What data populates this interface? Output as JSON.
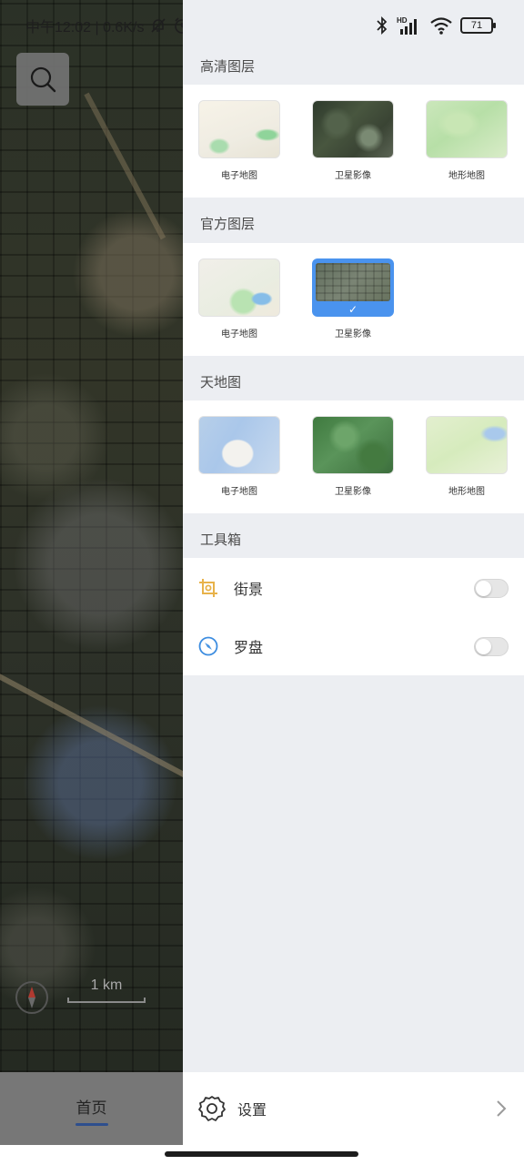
{
  "status_bar": {
    "time_speed": "中午12:02 | 0.6K/s",
    "battery": "71",
    "hd_label": "HD"
  },
  "map": {
    "scale_label": "1 km",
    "search_icon": "search-icon",
    "compass_icon": "compass-icon"
  },
  "bottom_nav": {
    "home_label": "首页"
  },
  "drawer": {
    "sections": [
      {
        "title": "高清图层",
        "items": [
          {
            "label": "电子地图",
            "thumb": "vector-map-thumb"
          },
          {
            "label": "卫星影像",
            "thumb": "satellite-thumb"
          },
          {
            "label": "地形地图",
            "thumb": "terrain-thumb"
          }
        ]
      },
      {
        "title": "官方图层",
        "items": [
          {
            "label": "电子地图",
            "thumb": "vector-map-thumb"
          },
          {
            "label": "卫星影像",
            "thumb": "satellite-thumb",
            "selected": true
          }
        ]
      },
      {
        "title": "天地图",
        "items": [
          {
            "label": "电子地图",
            "thumb": "vector-map-thumb"
          },
          {
            "label": "卫星影像",
            "thumb": "satellite-thumb"
          },
          {
            "label": "地形地图",
            "thumb": "terrain-thumb"
          }
        ]
      }
    ],
    "toolbox": {
      "title": "工具箱",
      "items": [
        {
          "label": "街景",
          "icon": "street-view-icon",
          "enabled": false
        },
        {
          "label": "罗盘",
          "icon": "compass-icon",
          "enabled": false
        }
      ]
    },
    "settings_label": "设置"
  },
  "colors": {
    "accent_blue": "#4a93ee",
    "nav_underline": "#2e4f8d",
    "street_view_icon": "#e8b24a",
    "compass_icon": "#3d8de0"
  }
}
